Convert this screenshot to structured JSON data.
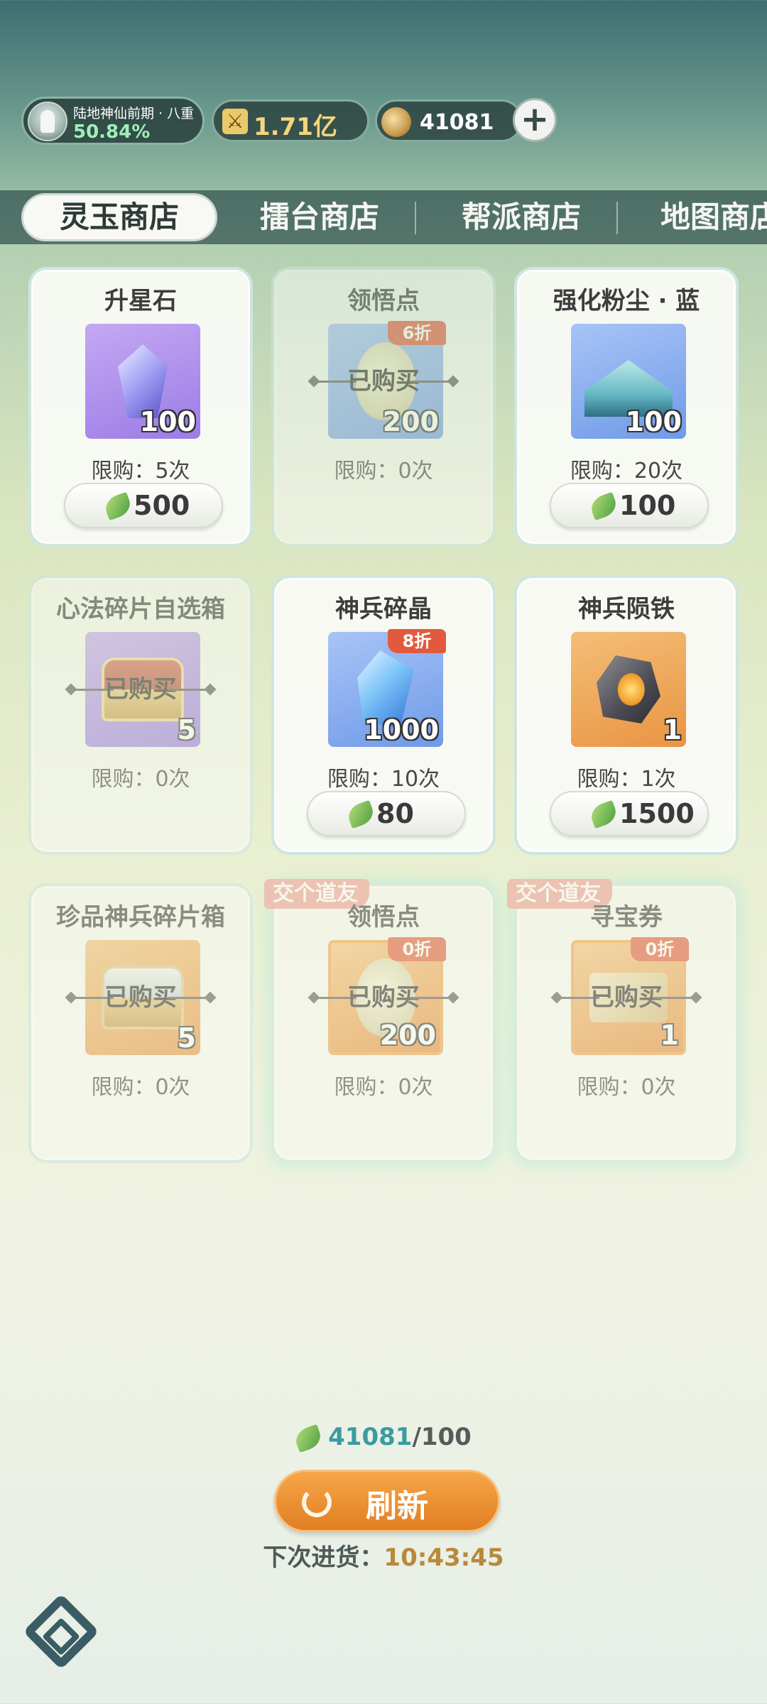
{
  "status": {
    "realm_name": "陆地神仙前期 · 八重",
    "realm_progress": "50.84%",
    "power": "1.71亿",
    "currency": "41081",
    "plus_label": "+"
  },
  "tabs": [
    {
      "label": "灵玉商店",
      "active": true
    },
    {
      "label": "擂台商店",
      "active": false
    },
    {
      "label": "帮派商店",
      "active": false
    },
    {
      "label": "地图商店",
      "active": false
    }
  ],
  "items": [
    {
      "name": "升星石",
      "qty": "100",
      "limit": "限购：5次",
      "price": "500",
      "sold": false,
      "icon": "star-stone-icon"
    },
    {
      "name": "领悟点",
      "qty": "200",
      "limit": "限购：0次",
      "sold": true,
      "discount": "6折",
      "sold_label": "已购买",
      "icon": "insight-point-icon"
    },
    {
      "name": "强化粉尘 · 蓝",
      "qty": "100",
      "limit": "限购：20次",
      "price": "100",
      "sold": false,
      "icon": "enhance-dust-icon"
    },
    {
      "name": "心法碎片自选箱",
      "qty": "5",
      "limit": "限购：0次",
      "sold": true,
      "sold_label": "已购买",
      "icon": "chest-icon"
    },
    {
      "name": "神兵碎晶",
      "qty": "1000",
      "limit": "限购：10次",
      "price": "80",
      "sold": false,
      "discount": "8折",
      "icon": "weapon-crystal-icon"
    },
    {
      "name": "神兵陨铁",
      "qty": "1",
      "limit": "限购：1次",
      "price": "1500",
      "sold": false,
      "icon": "meteor-iron-icon"
    },
    {
      "name": "珍品神兵碎片箱",
      "qty": "5",
      "limit": "限购：0次",
      "sold": true,
      "sold_label": "已购买",
      "icon": "rare-chest-icon"
    },
    {
      "name": "领悟点",
      "qty": "200",
      "limit": "限购：0次",
      "sold": true,
      "discount": "0折",
      "sold_label": "已购买",
      "tag": "交个道友",
      "icon": "insight-point-icon"
    },
    {
      "name": "寻宝券",
      "qty": "1",
      "limit": "限购：0次",
      "sold": true,
      "discount": "0折",
      "sold_label": "已购买",
      "tag": "交个道友",
      "icon": "treasure-ticket-icon"
    }
  ],
  "balance": {
    "have": "41081",
    "sep": "/",
    "need": "100"
  },
  "refresh_label": "刷新",
  "restock": {
    "label": "下次进货：",
    "time": "10:43:45"
  },
  "colors": {
    "accent_orange": "#e88b2c",
    "discount_red": "#e25a3d",
    "tab_bar": "#345652"
  }
}
